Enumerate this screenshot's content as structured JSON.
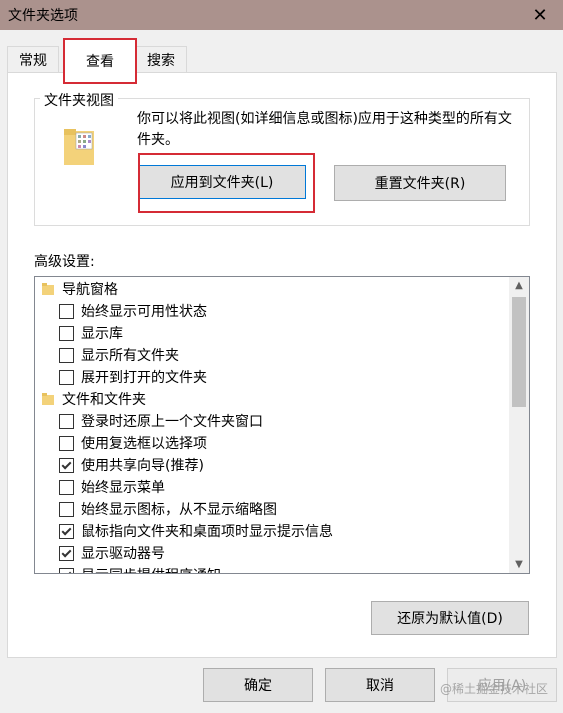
{
  "window": {
    "title": "文件夹选项"
  },
  "tabs": [
    "常规",
    "查看",
    "搜索"
  ],
  "folder_view": {
    "legend": "文件夹视图",
    "description": "你可以将此视图(如详细信息或图标)应用于这种类型的所有文件夹。",
    "apply_button": "应用到文件夹(L)",
    "reset_button": "重置文件夹(R)"
  },
  "advanced": {
    "label": "高级设置:",
    "items": [
      {
        "type": "group",
        "label": "导航窗格",
        "icon": "nav-pane-icon"
      },
      {
        "type": "check",
        "label": "始终显示可用性状态",
        "checked": false
      },
      {
        "type": "check",
        "label": "显示库",
        "checked": false
      },
      {
        "type": "check",
        "label": "显示所有文件夹",
        "checked": false
      },
      {
        "type": "check",
        "label": "展开到打开的文件夹",
        "checked": false
      },
      {
        "type": "group",
        "label": "文件和文件夹",
        "icon": "folder-icon"
      },
      {
        "type": "check",
        "label": "登录时还原上一个文件夹窗口",
        "checked": false
      },
      {
        "type": "check",
        "label": "使用复选框以选择项",
        "checked": false
      },
      {
        "type": "check",
        "label": "使用共享向导(推荐)",
        "checked": true
      },
      {
        "type": "check",
        "label": "始终显示菜单",
        "checked": false
      },
      {
        "type": "check",
        "label": "始终显示图标，从不显示缩略图",
        "checked": false
      },
      {
        "type": "check",
        "label": "鼠标指向文件夹和桌面项时显示提示信息",
        "checked": true
      },
      {
        "type": "check",
        "label": "显示驱动器号",
        "checked": true
      },
      {
        "type": "check",
        "label": "显示同步提供程序通知",
        "checked": true
      }
    ]
  },
  "buttons": {
    "restore": "还原为默认值(D)",
    "ok": "确定",
    "cancel": "取消",
    "apply": "应用(A)"
  },
  "watermark": "@稀土掘金技术社区",
  "colors": {
    "titlebar": "#ab928d",
    "highlight": "#d52b35",
    "focus": "#0078d7"
  }
}
